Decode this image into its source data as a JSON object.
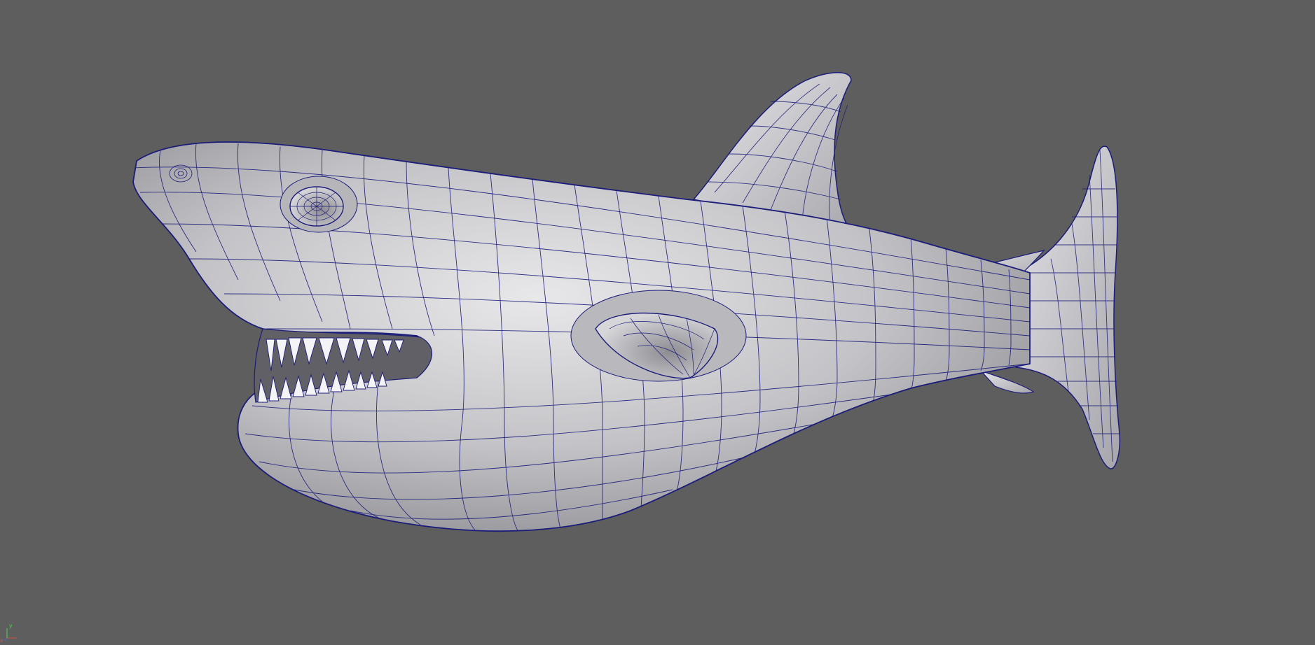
{
  "viewport": {
    "background": "#5e5e5e",
    "wireframe_color": "#1c1c7a",
    "surface_color": "#c9c9cc"
  },
  "model": {
    "icon": "shark-model-icon"
  },
  "axis_gizmo": {
    "x_label": "x",
    "y_label": "y",
    "x_color": "#d44d4d",
    "y_color": "#4dd44d"
  }
}
